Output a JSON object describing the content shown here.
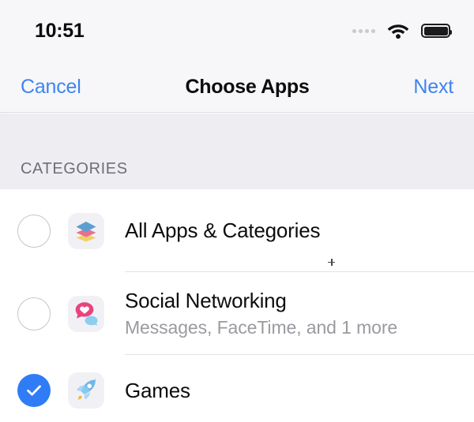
{
  "status_bar": {
    "time": "10:51",
    "signal_icon": "signal-dots-icon",
    "wifi_icon": "wifi-icon",
    "battery_icon": "battery-full-icon",
    "battery_level": 100
  },
  "nav_bar": {
    "cancel_label": "Cancel",
    "title": "Choose Apps",
    "next_label": "Next",
    "accent_color": "#3e84f0"
  },
  "section": {
    "header": "CATEGORIES"
  },
  "rows": [
    {
      "title": "All Apps & Categories",
      "subtitle": "",
      "selected": false,
      "control_icon": "empty-circle-icon",
      "app_icon": "layers-stack-icon"
    },
    {
      "title": "Social Networking",
      "subtitle": "Messages, FaceTime, and 1 more",
      "selected": false,
      "control_icon": "empty-circle-icon",
      "app_icon": "chat-bubbles-heart-icon"
    },
    {
      "title": "Games",
      "subtitle": "",
      "selected": true,
      "control_icon": "checkmark-circle-filled-icon",
      "app_icon": "rocket-icon"
    }
  ],
  "colors": {
    "accent": "#3e84f0",
    "selected_fill": "#2f7cf6",
    "section_bg": "#eeeef2",
    "bar_bg": "#f7f7f9",
    "subtitle_text": "#9a9aa0"
  }
}
